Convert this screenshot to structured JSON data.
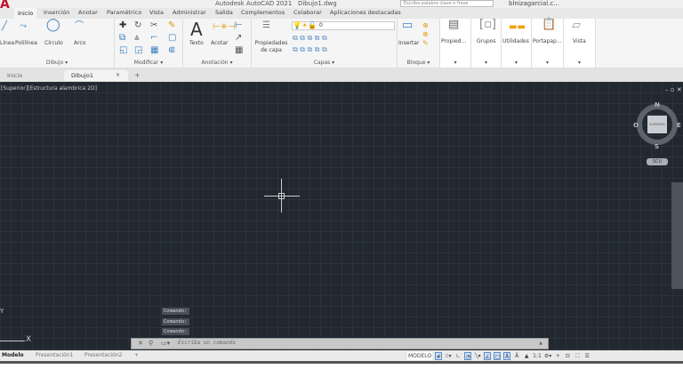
{
  "app": {
    "title": "Autodesk AutoCAD 2021   Dibujo1.dwg",
    "search_placeholder": "Escriba palabra clave o frase",
    "user": "blnizagarcial.c...",
    "logo": "A"
  },
  "ribbon_tabs": [
    "Inicio",
    "Inserción",
    "Anotar",
    "Paramétrico",
    "Vista",
    "Administrar",
    "Salida",
    "Complementos",
    "Colaborar",
    "Aplicaciones destacadas"
  ],
  "panels": {
    "dibujo": {
      "label": "Dibujo ▾",
      "tools": [
        "Línea",
        "Polilínea",
        "Círculo",
        "Arco"
      ]
    },
    "modificar": {
      "label": "Modificar ▾"
    },
    "anotacion": {
      "label": "Anotación ▾",
      "tools": [
        "Texto",
        "Acotar"
      ]
    },
    "capas": {
      "label": "Capas ▾",
      "tool": "Propiedades de capa",
      "current_layer": "0"
    },
    "bloque": {
      "label": "Bloque ▾",
      "tool": "Insertar"
    },
    "extra": [
      "Propied...",
      "Grupos",
      "Utilidades",
      "Portapap...",
      "Vista"
    ]
  },
  "doc_tabs": {
    "items": [
      "Inicio",
      "Dibujo1"
    ],
    "active": "Dibujo1",
    "close": "✕",
    "add": "+"
  },
  "viewport": {
    "label": "[Superior][Estructura alambrica 2D]",
    "background": "#212830"
  },
  "viewcube": {
    "n": "N",
    "s": "S",
    "e": "E",
    "w": "O",
    "face": "SUPERIOR",
    "ucs": "SCU"
  },
  "command": {
    "history": [
      "Comando:",
      "Comando:",
      "Comando:"
    ],
    "placeholder": "Escriba un comando"
  },
  "layout_tabs": [
    "Modelo",
    "Presentación1",
    "Presentación2",
    "+"
  ],
  "status": {
    "mode": "MODELO",
    "scale": "1:1"
  },
  "ucs": {
    "x": "X",
    "y": "Y"
  }
}
